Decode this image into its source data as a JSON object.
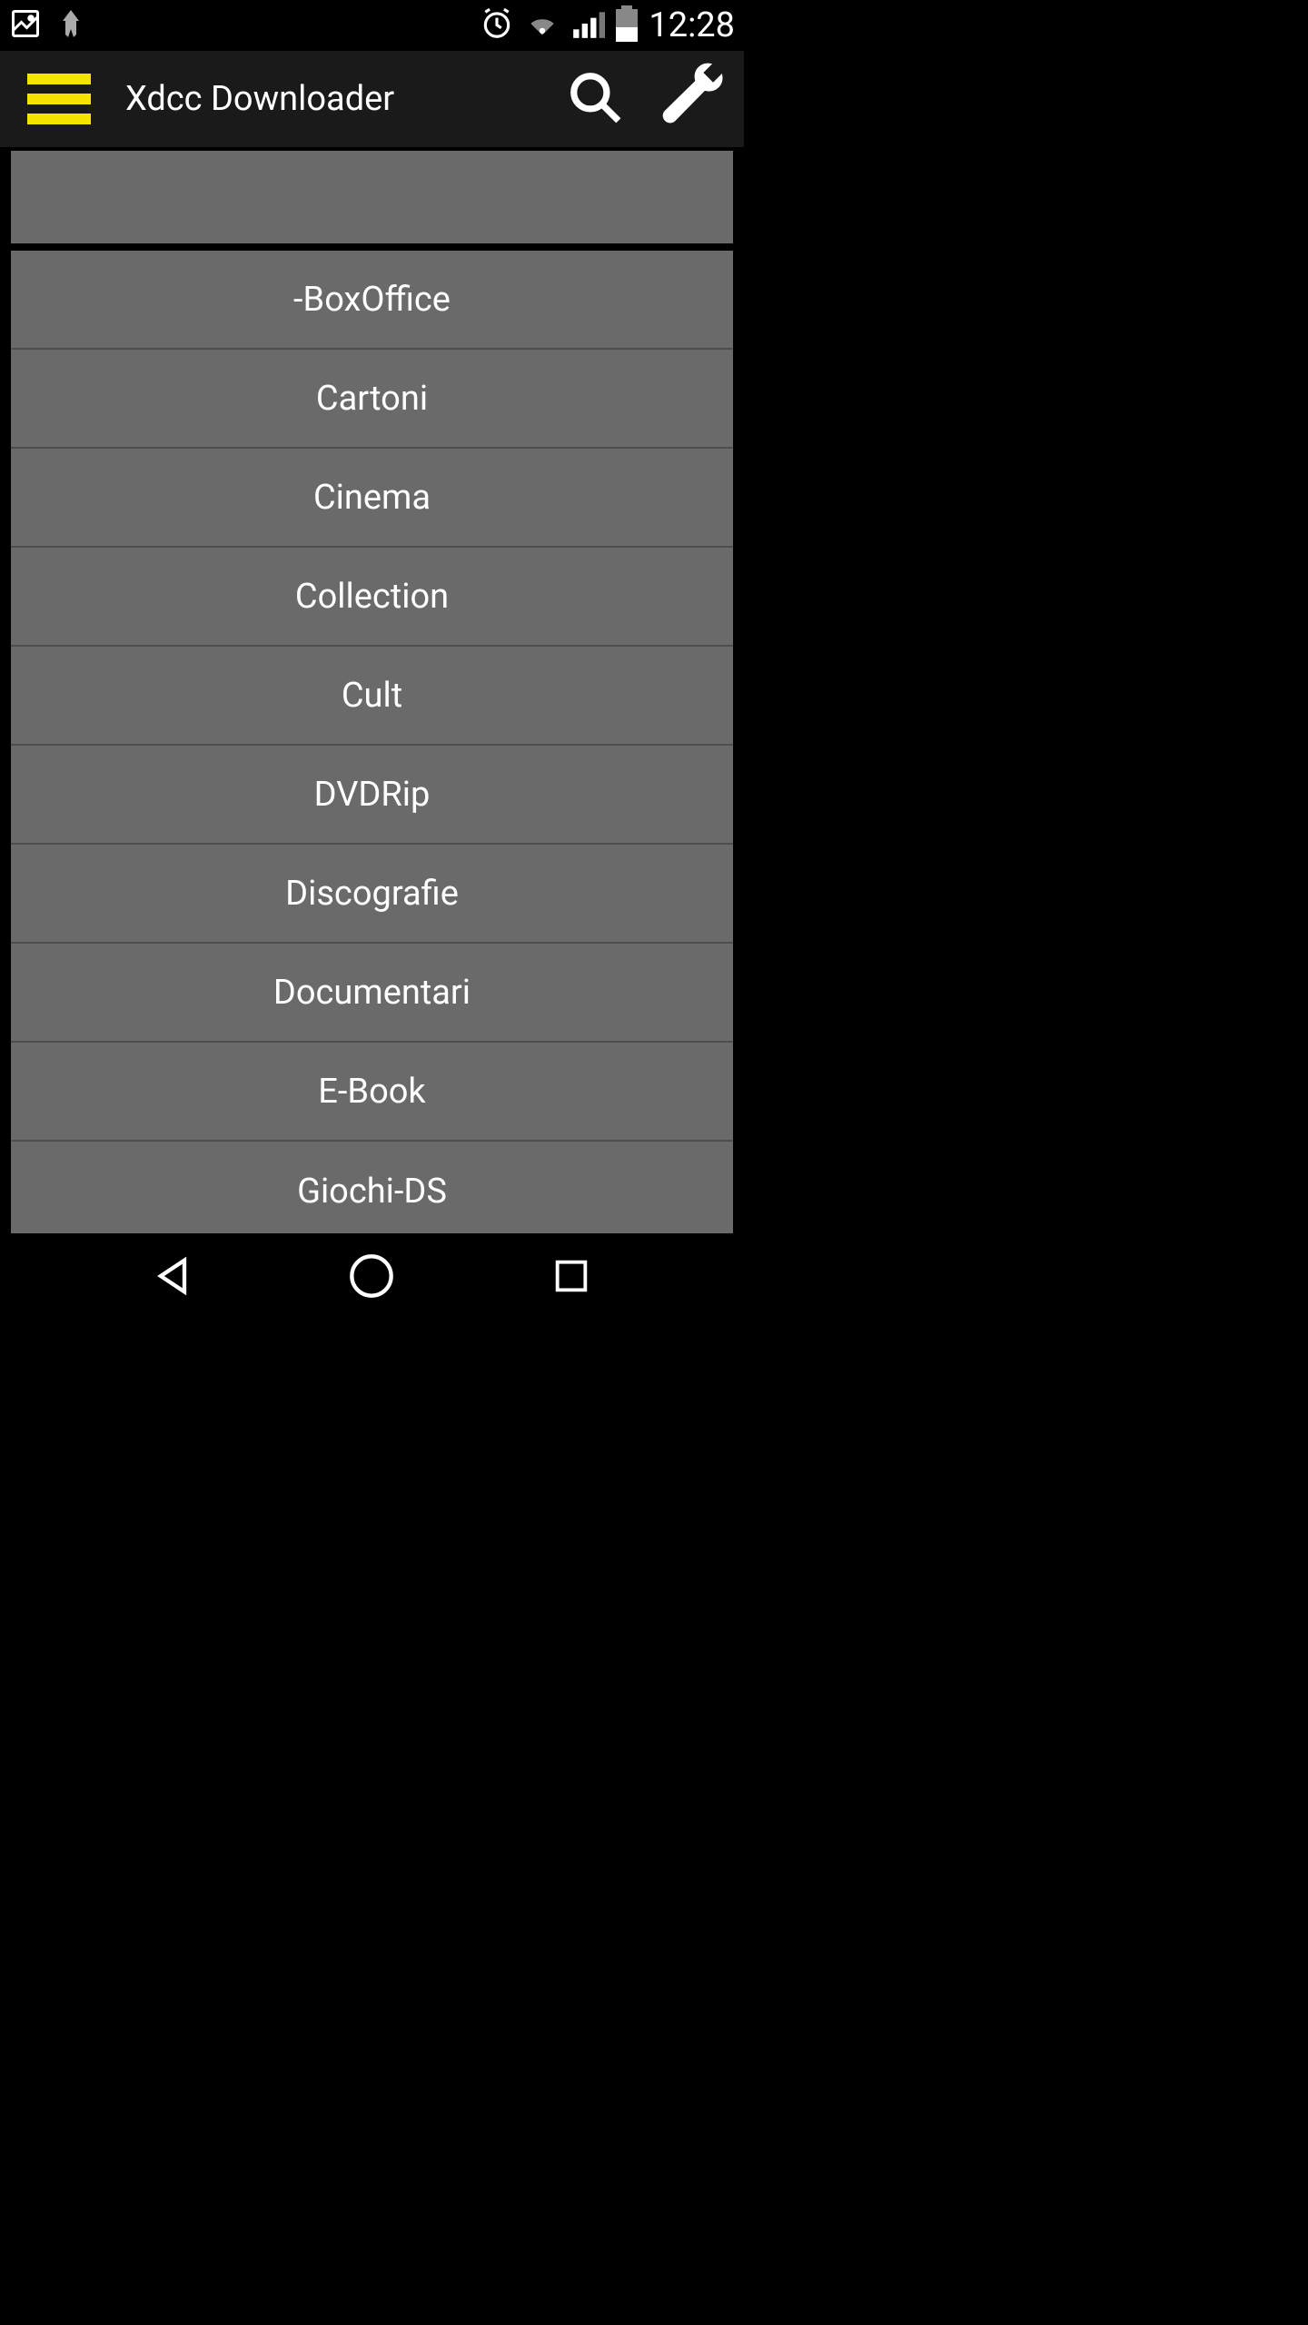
{
  "status": {
    "time": "12:28"
  },
  "appbar": {
    "title": "Xdcc Downloader"
  },
  "list": {
    "items": [
      {
        "label": ""
      },
      {
        "label": "-BoxOffice"
      },
      {
        "label": "Cartoni"
      },
      {
        "label": "Cinema"
      },
      {
        "label": "Collection"
      },
      {
        "label": "Cult"
      },
      {
        "label": "DVDRip"
      },
      {
        "label": "Discografie"
      },
      {
        "label": "Documentari"
      },
      {
        "label": "E-Book"
      },
      {
        "label": "Giochi-DS"
      }
    ]
  },
  "colors": {
    "accent": "#f5e400",
    "listBg": "#6a6a6a",
    "appBarBg": "#1a1a1a"
  }
}
